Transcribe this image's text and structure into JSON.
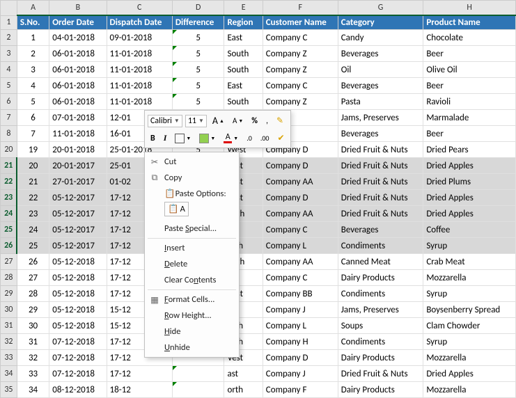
{
  "columns": [
    "A",
    "B",
    "C",
    "D",
    "E",
    "F",
    "G",
    "H"
  ],
  "headers": [
    "S.No.",
    "Order Date",
    "Dispatch Date",
    "Difference",
    "Region",
    "Customer Name",
    "Category",
    "Product Name"
  ],
  "rows": [
    {
      "r": "1",
      "d": []
    },
    {
      "r": "2",
      "d": [
        "1",
        "04-01-2018",
        "09-01-2018",
        "5",
        "East",
        "Company C",
        "Candy",
        "Chocolate"
      ]
    },
    {
      "r": "3",
      "d": [
        "2",
        "06-01-2018",
        "11-01-2018",
        "5",
        "South",
        "Company Z",
        "Beverages",
        "Beer"
      ]
    },
    {
      "r": "4",
      "d": [
        "3",
        "06-01-2018",
        "11-01-2018",
        "5",
        "South",
        "Company Z",
        "Oil",
        "Olive Oil"
      ]
    },
    {
      "r": "5",
      "d": [
        "4",
        "06-01-2018",
        "11-01-2018",
        "5",
        "East",
        "Company C",
        "Beverages",
        "Beer"
      ]
    },
    {
      "r": "6",
      "d": [
        "5",
        "06-01-2018",
        "11-01-2018",
        "5",
        "South",
        "Company Z",
        "Pasta",
        "Ravioli"
      ]
    },
    {
      "r": "7",
      "d": [
        "6",
        "07-01-2018",
        "12-01",
        "",
        "",
        "",
        "Jams, Preserves",
        "Marmalade"
      ]
    },
    {
      "r": "8",
      "d": [
        "7",
        "11-01-2018",
        "16-01",
        "",
        "",
        "",
        "Beverages",
        "Beer"
      ]
    },
    {
      "r": "20",
      "d": [
        "19",
        "20-01-2018",
        "25-01-2018",
        "5",
        "West",
        "Company D",
        "Dried Fruit & Nuts",
        "Dried Pears"
      ]
    },
    {
      "r": "21",
      "d": [
        "20",
        "20-01-2017",
        "25-01",
        "",
        "Vest",
        "Company D",
        "Dried Fruit & Nuts",
        "Dried Apples"
      ],
      "sel": true
    },
    {
      "r": "22",
      "d": [
        "21",
        "27-01-2017",
        "01-02",
        "",
        "Vest",
        "Company AA",
        "Dried Fruit & Nuts",
        "Dried Plums"
      ],
      "sel": true
    },
    {
      "r": "23",
      "d": [
        "22",
        "05-12-2017",
        "17-12",
        "",
        "Vest",
        "Company D",
        "Dried Fruit & Nuts",
        "Dried Apples"
      ],
      "sel": true
    },
    {
      "r": "24",
      "d": [
        "23",
        "05-12-2017",
        "17-12",
        "",
        "outh",
        "Company AA",
        "Dried Fruit & Nuts",
        "Dried Apples"
      ],
      "sel": true
    },
    {
      "r": "25",
      "d": [
        "24",
        "05-12-2017",
        "17-12",
        "",
        "ast",
        "Company C",
        "Beverages",
        "Coffee"
      ],
      "sel": true
    },
    {
      "r": "26",
      "d": [
        "25",
        "05-12-2017",
        "17-12",
        "",
        "orth",
        "Company L",
        "Condiments",
        "Syrup"
      ],
      "sel": true
    },
    {
      "r": "27",
      "d": [
        "26",
        "05-12-2018",
        "17-12",
        "",
        "outh",
        "Company AA",
        "Canned Meat",
        "Crab Meat"
      ]
    },
    {
      "r": "28",
      "d": [
        "27",
        "05-12-2018",
        "17-12",
        "",
        "ast",
        "Company C",
        "Dairy Products",
        "Mozzarella"
      ]
    },
    {
      "r": "29",
      "d": [
        "28",
        "05-12-2018",
        "17-12",
        "",
        "Vest",
        "Company BB",
        "Condiments",
        "Syrup"
      ]
    },
    {
      "r": "30",
      "d": [
        "29",
        "05-12-2018",
        "15-12",
        "",
        "ast",
        "Company J",
        "Jams, Preserves",
        "Boysenberry Spread"
      ]
    },
    {
      "r": "31",
      "d": [
        "30",
        "05-12-2018",
        "15-12",
        "",
        "orth",
        "Company L",
        "Soups",
        "Clam Chowder"
      ]
    },
    {
      "r": "32",
      "d": [
        "31",
        "07-12-2018",
        "17-12",
        "",
        "orth",
        "Company H",
        "Condiments",
        "Syrup"
      ]
    },
    {
      "r": "33",
      "d": [
        "32",
        "07-12-2018",
        "17-12",
        "",
        "Vest",
        "Company D",
        "Dairy Products",
        "Mozzarella"
      ]
    },
    {
      "r": "34",
      "d": [
        "33",
        "07-12-2018",
        "17-12",
        "",
        "ast",
        "Company J",
        "Dried Fruit & Nuts",
        "Dried Apples"
      ]
    },
    {
      "r": "35",
      "d": [
        "34",
        "08-12-2018",
        "18-12",
        "",
        "orth",
        "Company F",
        "Dairy Products",
        "Mozzarella"
      ]
    }
  ],
  "minibar": {
    "font": "Calibri",
    "size": "11",
    "bold": "B",
    "italic": "I",
    "bigA": "A",
    "smallA": "A",
    "fontColorA": "A",
    "percent": "%",
    "comma": ",",
    "incdec": ".0",
    "decinc": ".00"
  },
  "ctx": {
    "cut": "Cut",
    "copy": "Copy",
    "paste_opts": "Paste Options:",
    "paste_a": "A",
    "paste_special": "Paste Special...",
    "insert": "Insert",
    "delete": "Delete",
    "clear": "Clear Contents",
    "format": "Format Cells...",
    "rowh": "Row Height...",
    "hide": "Hide",
    "unhide": "Unhide"
  }
}
